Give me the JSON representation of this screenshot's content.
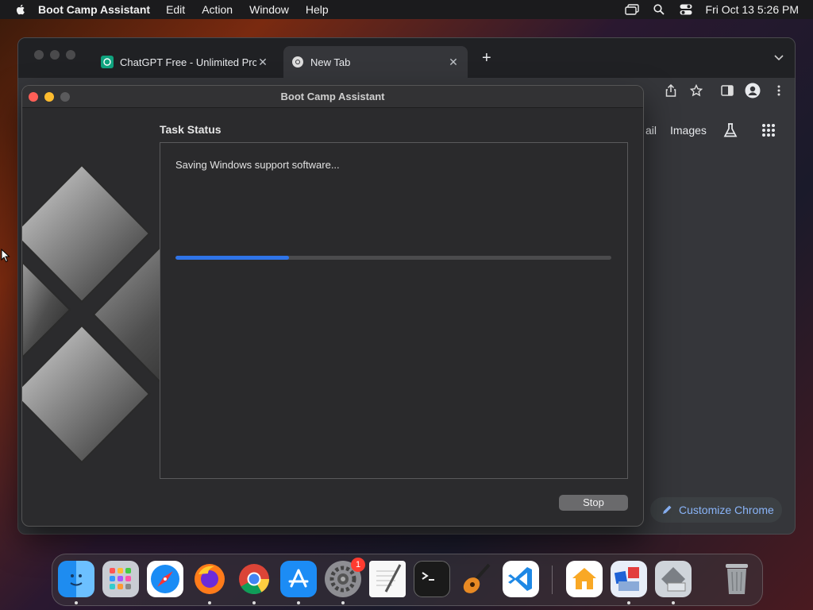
{
  "menubar": {
    "app_name": "Boot Camp Assistant",
    "menus": [
      "Edit",
      "Action",
      "Window",
      "Help"
    ],
    "clock": "Fri Oct 13  5:26 PM"
  },
  "browser": {
    "tabs": [
      {
        "title": "ChatGPT Free - Unlimited Pro",
        "icon": "chatgpt-icon",
        "active": false
      },
      {
        "title": "New Tab",
        "icon": "chrome-icon",
        "active": true
      }
    ],
    "ntp_links": {
      "gmail": "ail",
      "images": "Images"
    },
    "customize_label": "Customize Chrome"
  },
  "bootcamp": {
    "window_title": "Boot Camp Assistant",
    "section_title": "Task Status",
    "status_message": "Saving Windows support software...",
    "progress_fraction": 0.26,
    "stop_label": "Stop",
    "colors": {
      "progress": "#2f74e8"
    }
  },
  "dock": {
    "apps": [
      "Finder",
      "Launchpad",
      "Safari",
      "Firefox",
      "Google Chrome",
      "App Store",
      "System Settings",
      "TextEdit",
      "Terminal",
      "GarageBand",
      "Visual Studio Code",
      "Home",
      "Boot Camp Assistant",
      "Migration Assistant",
      "Trash"
    ],
    "system_settings_badge": "1"
  }
}
